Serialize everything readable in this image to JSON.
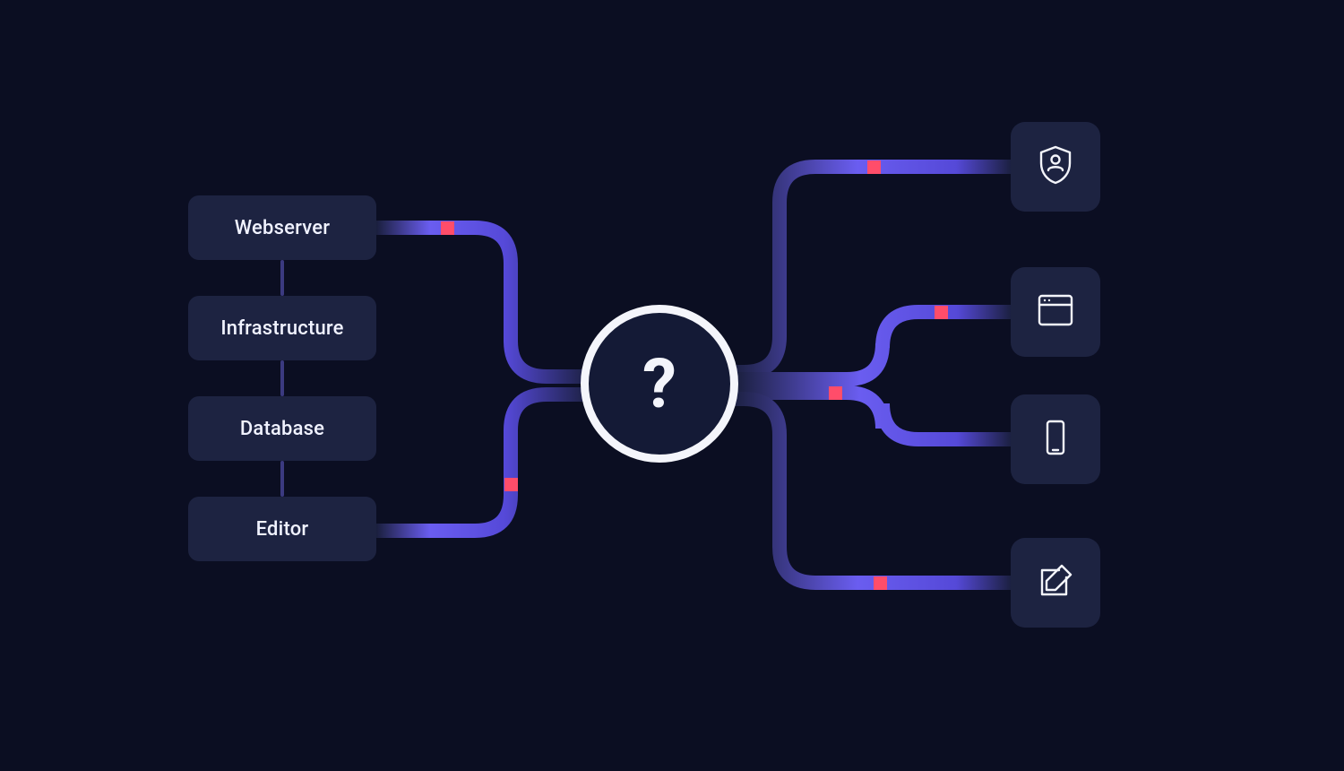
{
  "left_nodes": [
    {
      "id": "webserver",
      "label": "Webserver"
    },
    {
      "id": "infrastructure",
      "label": "Infrastructure"
    },
    {
      "id": "database",
      "label": "Database"
    },
    {
      "id": "editor",
      "label": "Editor"
    }
  ],
  "center": {
    "symbol": "?"
  },
  "right_nodes": [
    {
      "id": "security",
      "icon_name": "shield-user-icon"
    },
    {
      "id": "browser",
      "icon_name": "browser-window-icon"
    },
    {
      "id": "mobile",
      "icon_name": "mobile-device-icon"
    },
    {
      "id": "compose",
      "icon_name": "edit-compose-icon"
    }
  ],
  "connectors": [
    {
      "from": "webserver",
      "to": "center",
      "marker_side": "left"
    },
    {
      "from": "editor",
      "to": "center",
      "marker_side": "left"
    },
    {
      "from": "center",
      "to": "security",
      "marker_side": "right"
    },
    {
      "from": "center",
      "to": "browser",
      "marker_side": "right"
    },
    {
      "from": "center",
      "to": "mobile",
      "marker_side": "right"
    },
    {
      "from": "center",
      "to": "compose",
      "marker_side": "right"
    }
  ],
  "colors": {
    "bg": "#0b0e22",
    "card": "#1d2341",
    "stroke_light": "#f4f5fb",
    "accent_marker": "#ff4d6a",
    "grad_a": "#1a1f3d",
    "grad_b": "#6a5df0"
  }
}
